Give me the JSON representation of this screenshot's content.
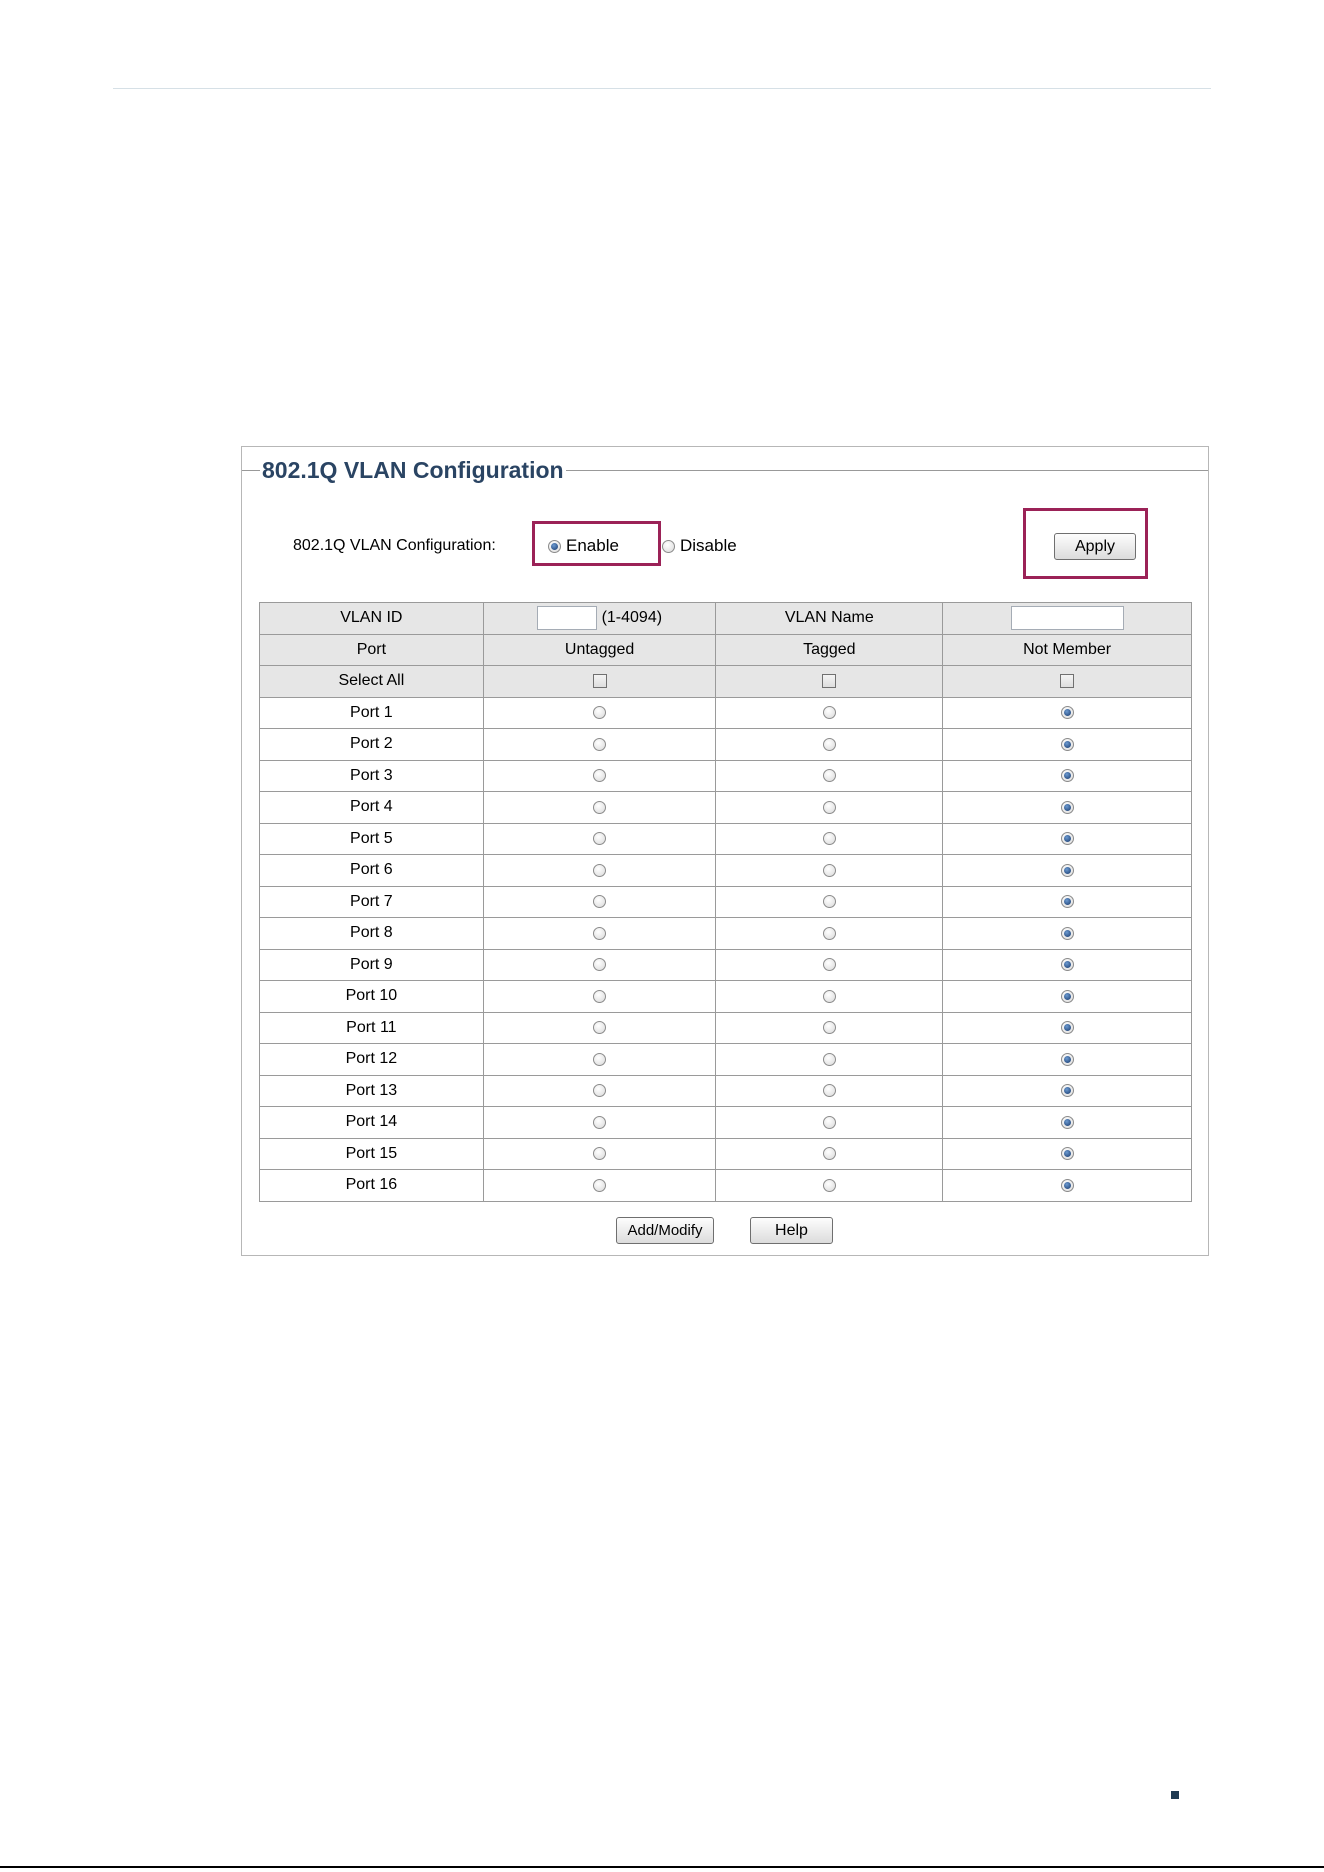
{
  "panel": {
    "title": "802.1Q VLAN Configuration",
    "config_label": "802.1Q VLAN Configuration:",
    "enable_label": "Enable",
    "disable_label": "Disable",
    "selected_mode": "Enable",
    "apply_label": "Apply"
  },
  "table": {
    "vlan_id_label": "VLAN ID",
    "vlan_id_value": "",
    "vlan_id_range": "(1-4094)",
    "vlan_name_label": "VLAN Name",
    "vlan_name_value": "",
    "headers": [
      "Port",
      "Untagged",
      "Tagged",
      "Not Member"
    ],
    "select_all_label": "Select All",
    "select_all": {
      "untagged": false,
      "tagged": false,
      "not_member": false
    },
    "ports": [
      {
        "name": "Port 1",
        "membership": "Not Member"
      },
      {
        "name": "Port 2",
        "membership": "Not Member"
      },
      {
        "name": "Port 3",
        "membership": "Not Member"
      },
      {
        "name": "Port 4",
        "membership": "Not Member"
      },
      {
        "name": "Port 5",
        "membership": "Not Member"
      },
      {
        "name": "Port 6",
        "membership": "Not Member"
      },
      {
        "name": "Port 7",
        "membership": "Not Member"
      },
      {
        "name": "Port 8",
        "membership": "Not Member"
      },
      {
        "name": "Port 9",
        "membership": "Not Member"
      },
      {
        "name": "Port 10",
        "membership": "Not Member"
      },
      {
        "name": "Port 11",
        "membership": "Not Member"
      },
      {
        "name": "Port 12",
        "membership": "Not Member"
      },
      {
        "name": "Port 13",
        "membership": "Not Member"
      },
      {
        "name": "Port 14",
        "membership": "Not Member"
      },
      {
        "name": "Port 15",
        "membership": "Not Member"
      },
      {
        "name": "Port 16",
        "membership": "Not Member"
      }
    ]
  },
  "buttons": {
    "add_modify_label": "Add/Modify",
    "help_label": "Help"
  },
  "colors": {
    "highlight": "#9b2257",
    "title": "#2a4463",
    "header_bg": "#e6e6e6"
  }
}
